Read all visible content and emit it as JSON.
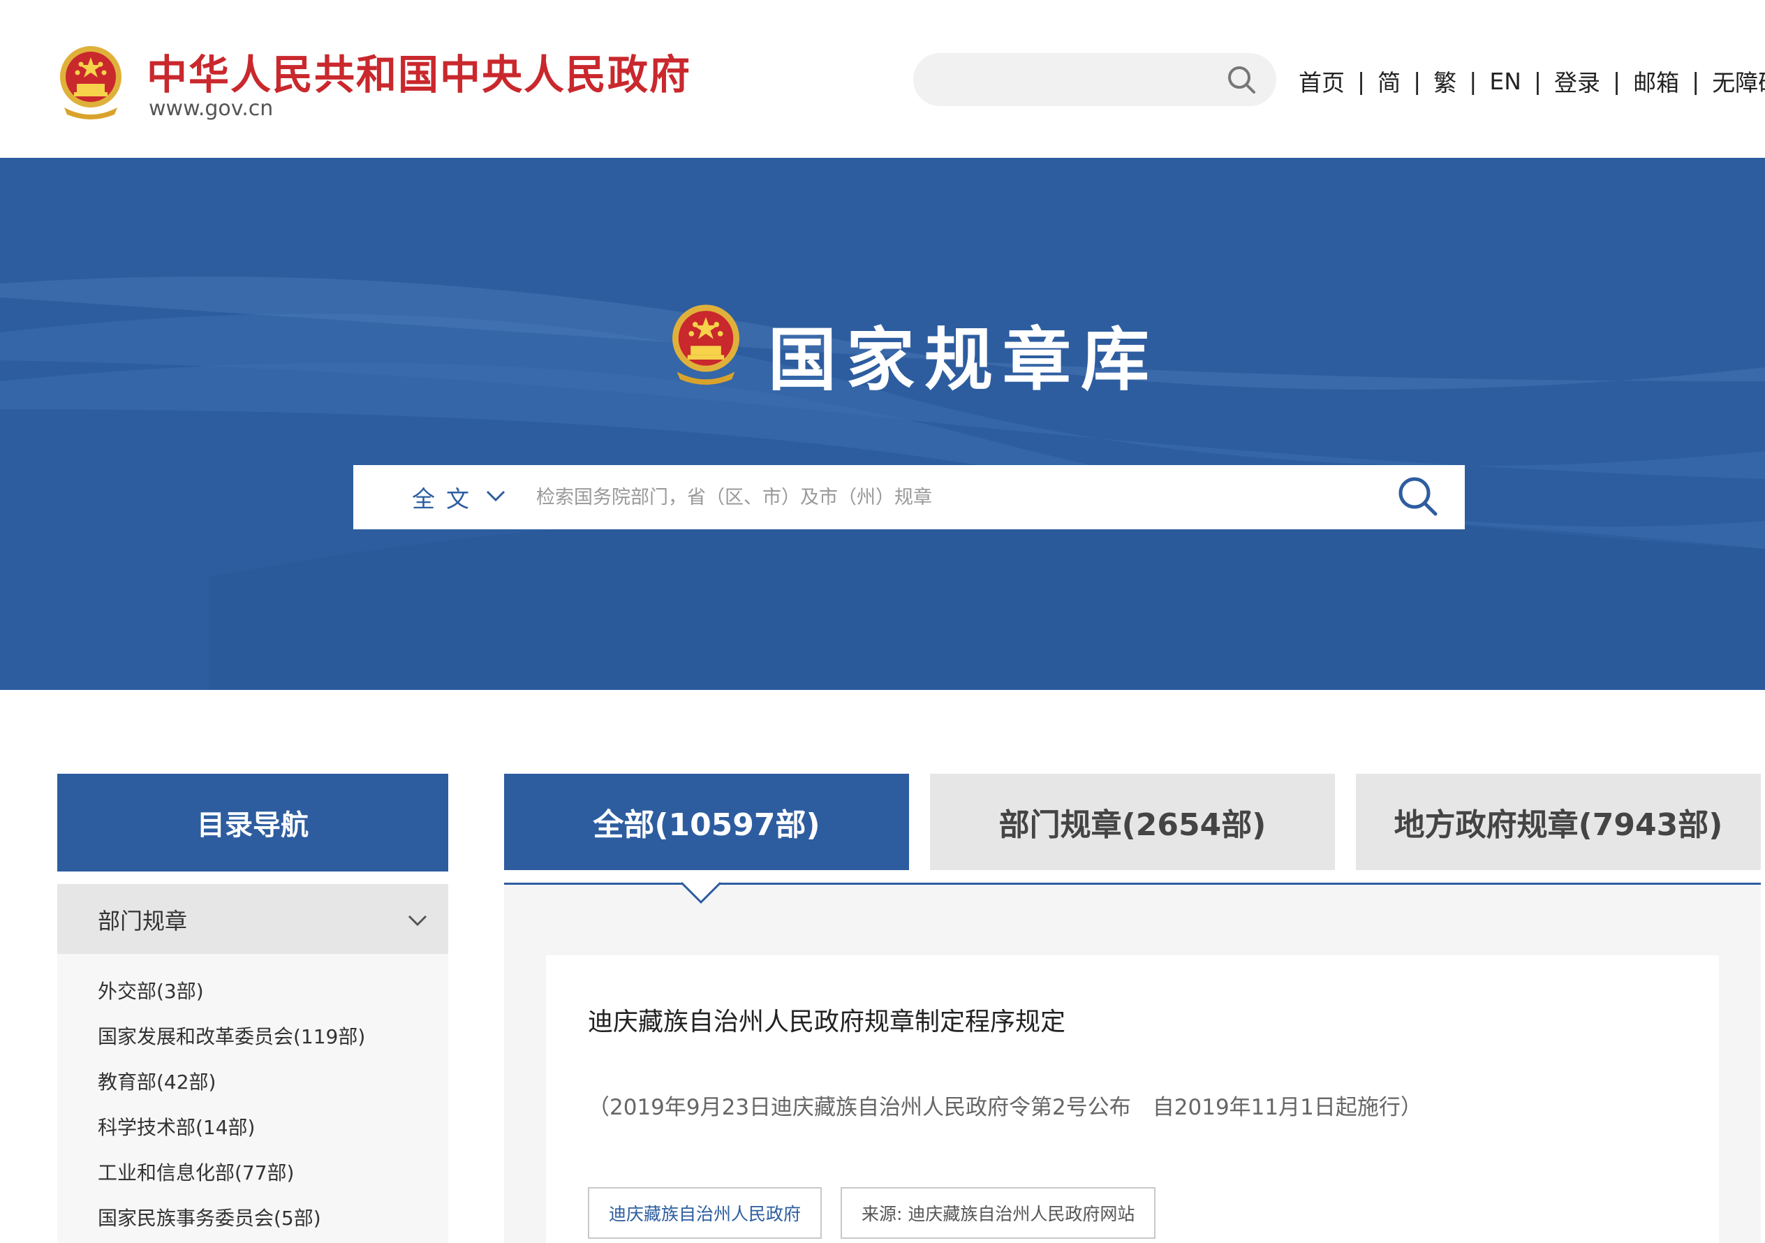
{
  "header": {
    "site_title": "中华人民共和国中央人民政府",
    "site_url": "www.gov.cn",
    "search_placeholder": "",
    "nav": [
      "首页",
      "简",
      "繁",
      "EN",
      "登录",
      "邮箱",
      "无障碍"
    ],
    "brand_color": "#c9282d"
  },
  "banner": {
    "title": "国家规章库",
    "search": {
      "scope": "全文",
      "placeholder": "检索国务院部门，省（区、市）及市（州）规章"
    },
    "color": "#2d5d9f"
  },
  "sidebar": {
    "heading": "目录导航",
    "group_label": "部门规章",
    "items": [
      "外交部(3部)",
      "国家发展和改革委员会(119部)",
      "教育部(42部)",
      "科学技术部(14部)",
      "工业和信息化部(77部)",
      "国家民族事务委员会(5部)"
    ]
  },
  "tabs": [
    {
      "label": "全部(10597部)",
      "active": true
    },
    {
      "label": "部门规章(2654部)",
      "active": false
    },
    {
      "label": "地方政府规章(7943部)",
      "active": false
    }
  ],
  "result": {
    "title": "迪庆藏族自治州人民政府规章制定程序规定",
    "subtitle": "（2019年9月23日迪庆藏族自治州人民政府令第2号公布　自2019年11月1日起施行）",
    "tag_issuer": "迪庆藏族自治州人民政府",
    "tag_source": "来源: 迪庆藏族自治州人民政府网站"
  }
}
